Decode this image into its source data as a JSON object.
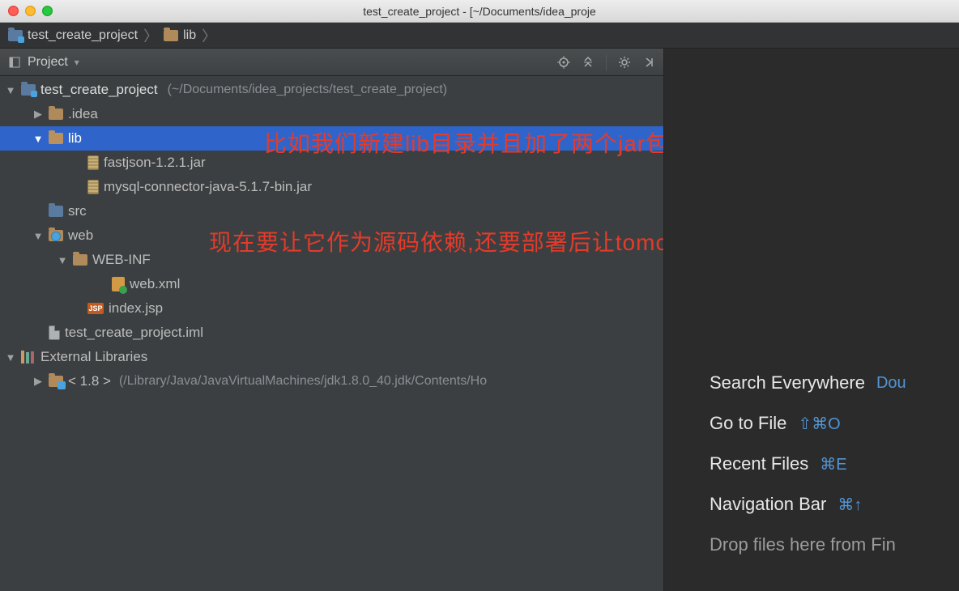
{
  "window": {
    "title": "test_create_project - [~/Documents/idea_proje"
  },
  "breadcrumb": {
    "items": [
      {
        "label": "test_create_project",
        "icon": "module-folder"
      },
      {
        "label": "lib",
        "icon": "folder"
      }
    ]
  },
  "projectToolbar": {
    "label": "Project"
  },
  "tree": {
    "root": {
      "name": "test_create_project",
      "path": "(~/Documents/idea_projects/test_create_project)"
    },
    "idea": ".idea",
    "lib": {
      "name": "lib",
      "jars": [
        "fastjson-1.2.1.jar",
        "mysql-connector-java-5.1.7-bin.jar"
      ]
    },
    "src": "src",
    "web": {
      "name": "web",
      "webinf": "WEB-INF",
      "webxml": "web.xml",
      "index": "index.jsp"
    },
    "iml": "test_create_project.iml",
    "external": {
      "label": "External Libraries",
      "sdk_prefix": "< 1.8 >",
      "sdk_path": "(/Library/Java/JavaVirtualMachines/jdk1.8.0_40.jdk/Contents/Ho"
    }
  },
  "annotations": {
    "line1": "比如我们新建lib目录并且加了两个jar包",
    "line2": "现在要让它作为源码依赖,还要部署后让tomcat依赖"
  },
  "editorHints": {
    "search": {
      "label": "Search Everywhere",
      "shortcut": "Dou"
    },
    "goto": {
      "label": "Go to File",
      "shortcut": "⇧⌘O"
    },
    "recent": {
      "label": "Recent Files",
      "shortcut": "⌘E"
    },
    "nav": {
      "label": "Navigation Bar",
      "shortcut": "⌘↑"
    },
    "drop": "Drop files here from Fin"
  }
}
